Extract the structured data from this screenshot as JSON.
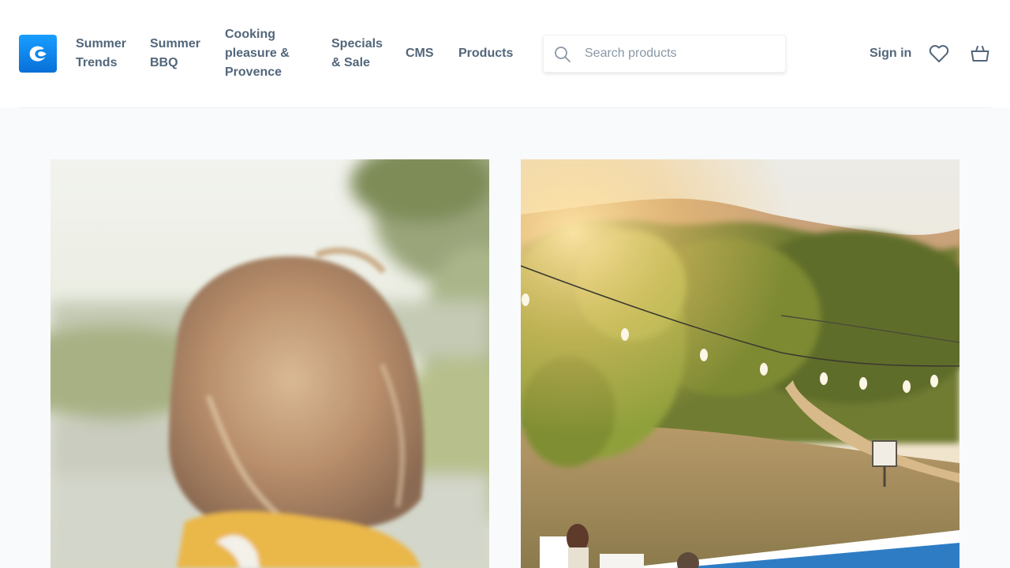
{
  "brand": {
    "logo_name": "shopware-logo",
    "accent": "#189eff"
  },
  "nav": {
    "items": [
      {
        "label": "Summer\nTrends"
      },
      {
        "label": "Summer\nBBQ"
      },
      {
        "label": "Cooking\npleasure &\nProvence"
      },
      {
        "label": "Specials\n& Sale"
      },
      {
        "label": "CMS"
      },
      {
        "label": "Products"
      }
    ]
  },
  "search": {
    "placeholder": "Search products",
    "value": ""
  },
  "account": {
    "signin_label": "Sign in"
  },
  "icons": {
    "search": "search-icon",
    "wishlist": "heart-icon",
    "cart": "basket-icon"
  },
  "colors": {
    "text": "#52667a",
    "background": "#f8fafc"
  }
}
